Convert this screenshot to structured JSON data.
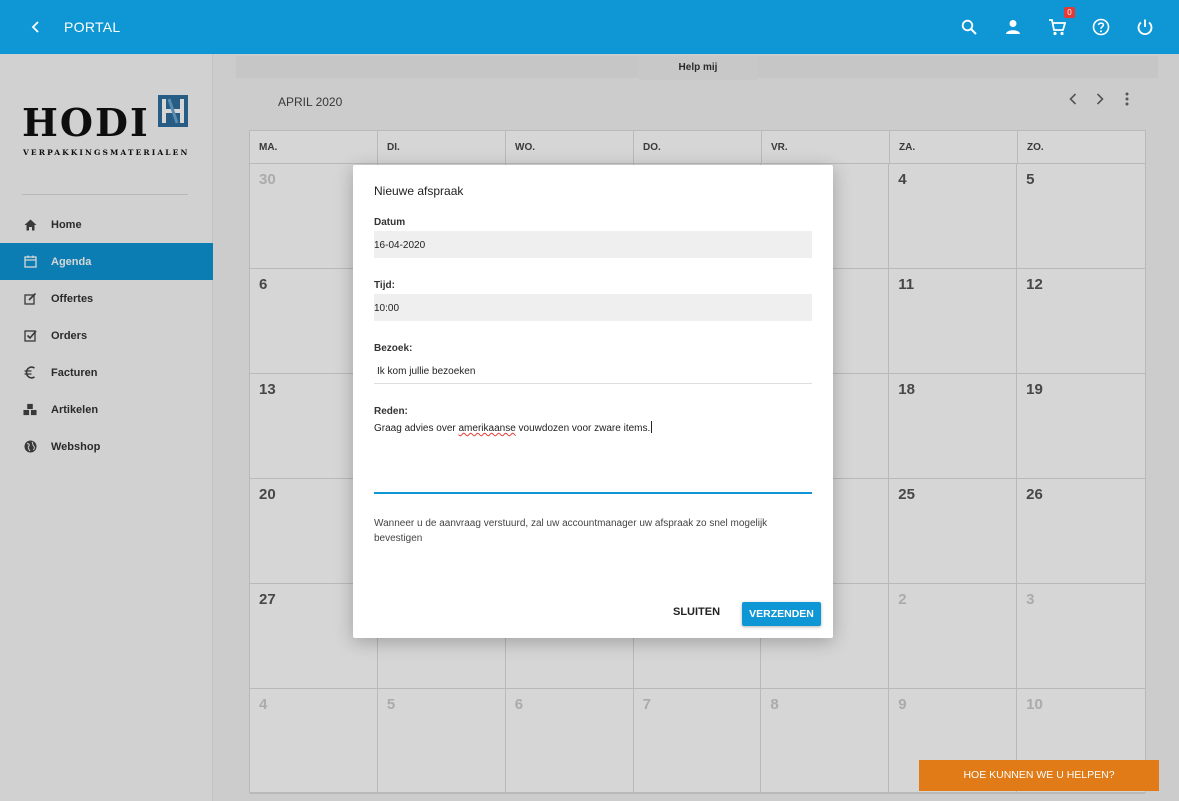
{
  "topbar": {
    "title": "PORTAL",
    "cart_count": "0"
  },
  "logo": {
    "word": "HODI",
    "sub": "VERPAKKINGSMATERIALEN"
  },
  "sidebar": {
    "items": [
      {
        "label": "Home",
        "icon": "home-icon"
      },
      {
        "label": "Agenda",
        "icon": "calendar-icon"
      },
      {
        "label": "Offertes",
        "icon": "edit-icon"
      },
      {
        "label": "Orders",
        "icon": "checkbox-icon"
      },
      {
        "label": "Facturen",
        "icon": "euro-icon"
      },
      {
        "label": "Artikelen",
        "icon": "cubes-icon"
      },
      {
        "label": "Webshop",
        "icon": "globe-icon"
      }
    ]
  },
  "help_tab": "Help mij",
  "calendar": {
    "month": "APRIL 2020",
    "weekdays": [
      "MA.",
      "DI.",
      "WO.",
      "DO.",
      "VR.",
      "ZA.",
      "ZO."
    ],
    "weeks": [
      [
        "30",
        "",
        "",
        "",
        "",
        "4",
        "5"
      ],
      [
        "6",
        "",
        "",
        "",
        "",
        "11",
        "12"
      ],
      [
        "13",
        "",
        "",
        "",
        "",
        "18",
        "19"
      ],
      [
        "20",
        "",
        "",
        "",
        "",
        "25",
        "26"
      ],
      [
        "27",
        "",
        "",
        "",
        "",
        "2",
        "3"
      ],
      [
        "4",
        "5",
        "6",
        "7",
        "8",
        "9",
        "10"
      ]
    ]
  },
  "dialog": {
    "title": "Nieuwe afspraak",
    "date_label": "Datum",
    "date_value": "16-04-2020",
    "time_label": "Tijd:",
    "time_value": "10:00",
    "visit_label": "Bezoek:",
    "visit_value": "Ik kom jullie bezoeken",
    "reason_label": "Reden:",
    "reason_before": "Graag advies over ",
    "reason_misspelled": "amerikaanse",
    "reason_after": " vouwdozen voor zware items.",
    "note": "Wanneer u de aanvraag verstuurd, zal uw accountmanager uw afspraak zo snel mogelijk bevestigen",
    "close_label": "SLUITEN",
    "send_label": "VERZENDEN"
  },
  "cta": "HOE KUNNEN WE U HELPEN?"
}
